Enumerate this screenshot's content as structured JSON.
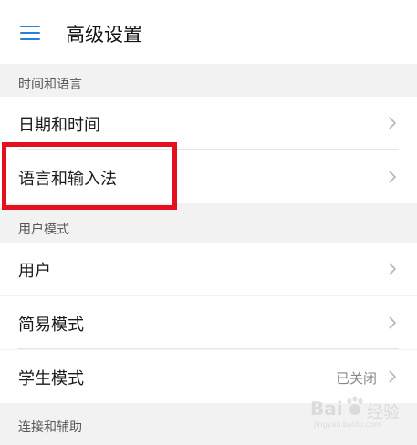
{
  "header": {
    "title": "高级设置",
    "menu_icon": "menu-icon"
  },
  "sections": [
    {
      "label": "时间和语言",
      "items": [
        {
          "label": "日期和时间",
          "value": ""
        },
        {
          "label": "语言和输入法",
          "value": ""
        }
      ]
    },
    {
      "label": "用户模式",
      "items": [
        {
          "label": "用户",
          "value": ""
        },
        {
          "label": "简易模式",
          "value": ""
        },
        {
          "label": "学生模式",
          "value": "已关闭"
        }
      ]
    },
    {
      "label": "连接和辅助",
      "items": []
    }
  ],
  "colors": {
    "accent": "#2a7de1",
    "highlight": "#e4101e",
    "background": "#f2f2f2"
  },
  "watermark": {
    "brand_latin": "Bai",
    "brand_cn": "经验",
    "sub": "jingyan.baidu.com"
  }
}
